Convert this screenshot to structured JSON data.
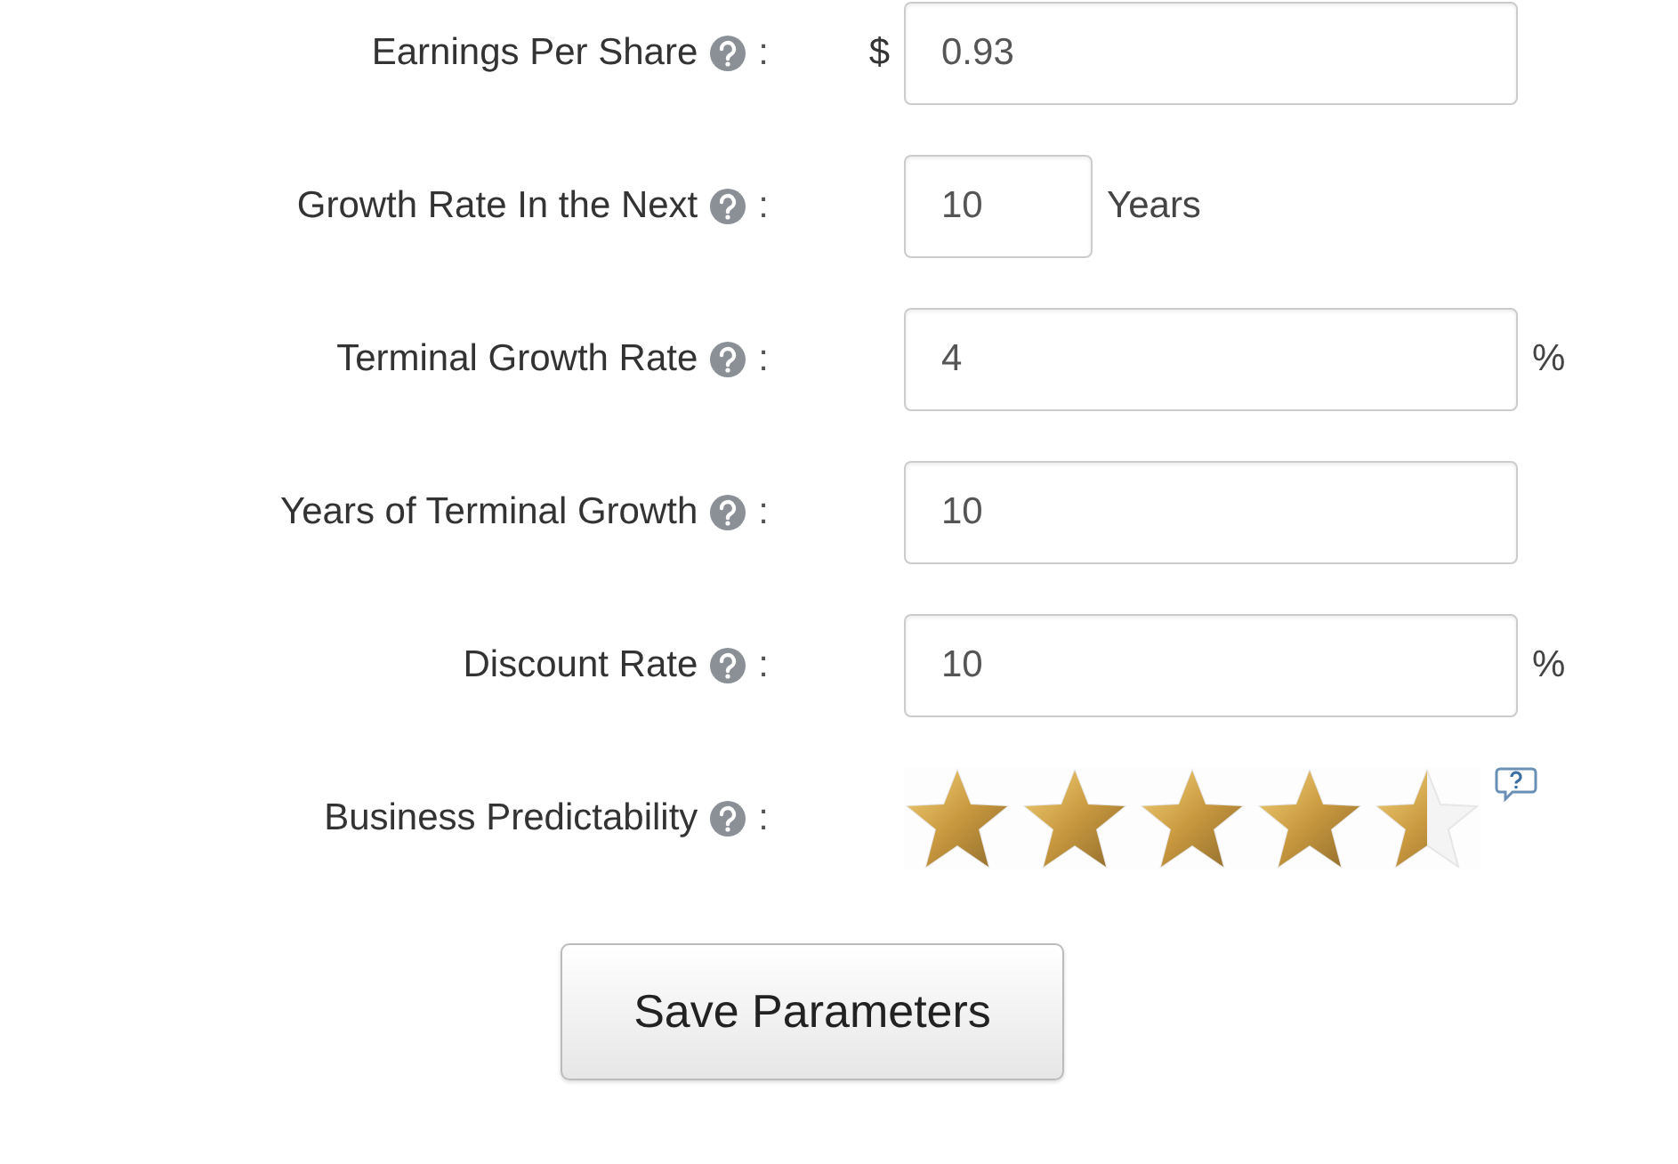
{
  "rows": [
    {
      "kind": "input",
      "label": "Earnings Per Share",
      "prefix": "$",
      "value": "0.93"
    },
    {
      "kind": "short-input",
      "label": "Growth Rate In the Next",
      "value": "10",
      "suffix": "Years"
    },
    {
      "kind": "input",
      "label": "Terminal Growth Rate",
      "value": "4",
      "suffix": "%"
    },
    {
      "kind": "input",
      "label": "Years of Terminal Growth",
      "value": "10"
    },
    {
      "kind": "input",
      "label": "Discount Rate",
      "value": "10",
      "suffix": "%"
    },
    {
      "kind": "stars",
      "label": "Business Predictability",
      "stars": 4.5
    }
  ],
  "separator": ":",
  "button": "Save Parameters"
}
